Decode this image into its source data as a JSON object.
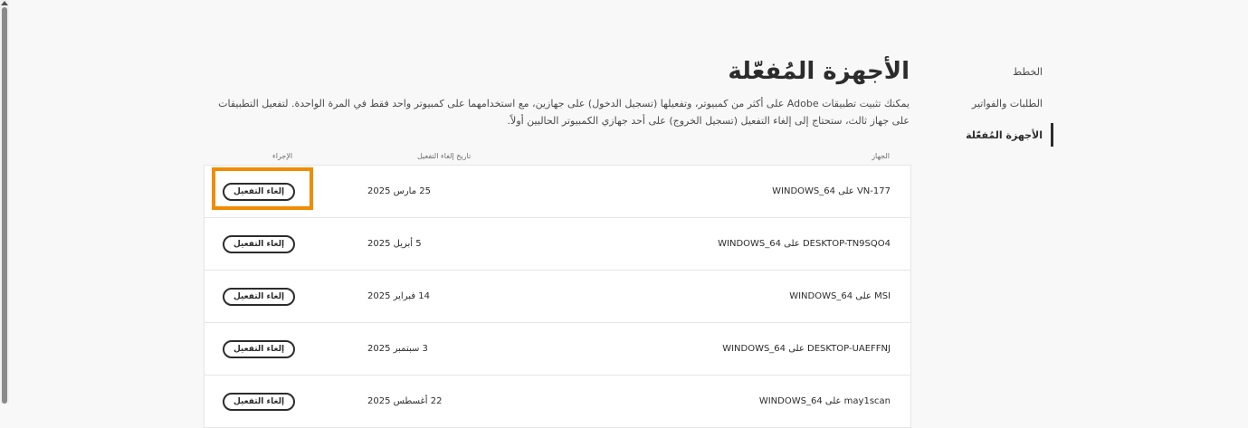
{
  "nav": {
    "items": [
      {
        "label": "الخطط"
      },
      {
        "label": "الطلبات والفواتير"
      },
      {
        "label": "الأجهزة المُفعّلة"
      }
    ]
  },
  "page": {
    "title": "الأجهزة المُفعّلة",
    "desc_line1": "يمكنك تثبيت تطبيقات Adobe على أكثر من كمبيوتر، وتفعيلها (تسجيل الدخول) على جهازين، مع استخدامهما على كمبيوتر واحد فقط في المرة الواحدة. لتفعيل التطبيقات",
    "desc_line2": "على جهاز ثالث، ستحتاج إلى إلغاء التفعيل (تسجيل الخروج) على أحد جهازي الكمبيوتر الحاليين أولاً."
  },
  "table": {
    "columns": {
      "device": "الجهاز",
      "date": "تاريخ إلغاء التفعيل",
      "action": "الإجراء"
    },
    "rows": [
      {
        "device": "VN-177 على WINDOWS_64",
        "date": "25 مارس 2025",
        "action": "إلغاء التفعيل"
      },
      {
        "device": "DESKTOP-TN9SQO4 على WINDOWS_64",
        "date": "5 أبريل 2025",
        "action": "إلغاء التفعيل"
      },
      {
        "device": "MSI على WINDOWS_64",
        "date": "14 فبراير 2025",
        "action": "إلغاء التفعيل"
      },
      {
        "device": "DESKTOP-UAEFFNJ على WINDOWS_64",
        "date": "3 سبتمبر 2025",
        "action": "إلغاء التفعيل"
      },
      {
        "device": "may1scan على WINDOWS_64",
        "date": "22 أغسطس 2025",
        "action": "إلغاء التفعيل"
      }
    ]
  },
  "colors": {
    "highlight": "#f08c00",
    "text": "#2c2c2c",
    "background": "#f8f8f8"
  }
}
